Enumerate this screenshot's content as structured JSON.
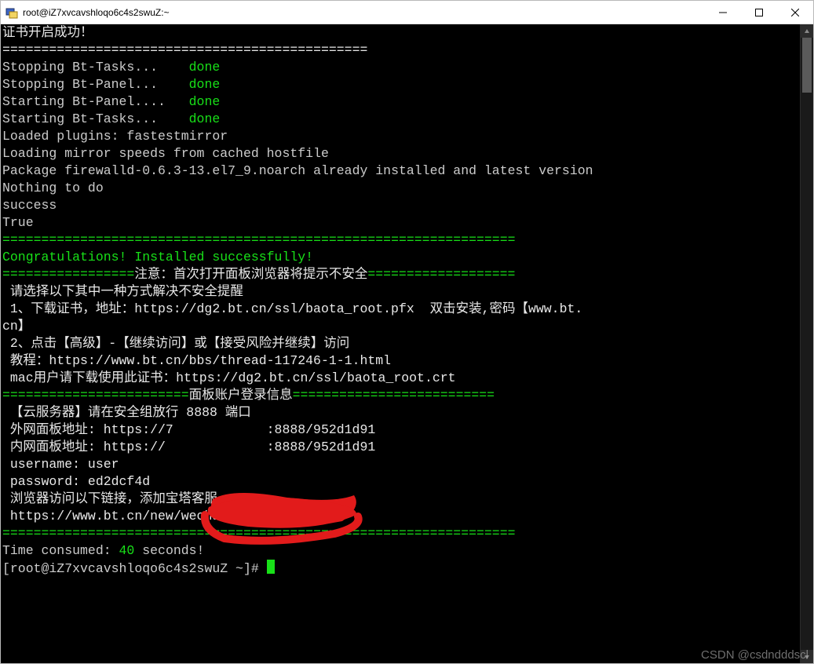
{
  "titlebar": {
    "title": "root@iZ7xvcavshloqo6c4s2swuZ:~"
  },
  "colors": {
    "term_bg": "#000000",
    "term_fg": "#cccccc",
    "green": "#18e018",
    "redact": "#e21b1b"
  },
  "terminal": {
    "lines": [
      {
        "segments": [
          {
            "text": "证书开启成功！",
            "class": "white"
          }
        ]
      },
      {
        "segments": [
          {
            "text": "===============================================",
            "class": "white"
          }
        ]
      },
      {
        "segments": [
          {
            "text": "",
            "class": ""
          }
        ]
      },
      {
        "segments": [
          {
            "text": "Stopping Bt-Tasks...    ",
            "class": "gray"
          },
          {
            "text": "done",
            "class": "green"
          }
        ]
      },
      {
        "segments": [
          {
            "text": "Stopping Bt-Panel...    ",
            "class": "gray"
          },
          {
            "text": "done",
            "class": "green"
          }
        ]
      },
      {
        "segments": [
          {
            "text": "Starting Bt-Panel....   ",
            "class": "gray"
          },
          {
            "text": "done",
            "class": "green"
          }
        ]
      },
      {
        "segments": [
          {
            "text": "Starting Bt-Tasks...    ",
            "class": "gray"
          },
          {
            "text": "done",
            "class": "green"
          }
        ]
      },
      {
        "segments": [
          {
            "text": "Loaded plugins: fastestmirror",
            "class": "gray"
          }
        ]
      },
      {
        "segments": [
          {
            "text": "Loading mirror speeds from cached hostfile",
            "class": "gray"
          }
        ]
      },
      {
        "segments": [
          {
            "text": "Package firewalld-0.6.3-13.el7_9.noarch already installed and latest version",
            "class": "gray"
          }
        ]
      },
      {
        "segments": [
          {
            "text": "Nothing to do",
            "class": "gray"
          }
        ]
      },
      {
        "segments": [
          {
            "text": "success",
            "class": "gray"
          }
        ]
      },
      {
        "segments": [
          {
            "text": "True",
            "class": "gray"
          }
        ]
      },
      {
        "segments": [
          {
            "text": "==================================================================",
            "class": "green"
          }
        ]
      },
      {
        "segments": [
          {
            "text": "Congratulations! Installed successfully!",
            "class": "green"
          }
        ]
      },
      {
        "segments": [
          {
            "text": "=================",
            "class": "green"
          },
          {
            "text": "注意：首次打开面板浏览器将提示不安全",
            "class": "white"
          },
          {
            "text": "===================",
            "class": "green"
          }
        ]
      },
      {
        "segments": [
          {
            "text": "",
            "class": ""
          }
        ]
      },
      {
        "segments": [
          {
            "text": " 请选择以下其中一种方式解决不安全提醒",
            "class": "white"
          }
        ]
      },
      {
        "segments": [
          {
            "text": " 1、下载证书，地址：https://dg2.bt.cn/ssl/baota_root.pfx  双击安装,密码【www.bt.",
            "class": "white"
          }
        ]
      },
      {
        "segments": [
          {
            "text": "cn】",
            "class": "white"
          }
        ]
      },
      {
        "segments": [
          {
            "text": " 2、点击【高级】-【继续访问】或【接受风险并继续】访问",
            "class": "white"
          }
        ]
      },
      {
        "segments": [
          {
            "text": " 教程：https://www.bt.cn/bbs/thread-117246-1-1.html",
            "class": "white"
          }
        ]
      },
      {
        "segments": [
          {
            "text": " mac用户请下载使用此证书：https://dg2.bt.cn/ssl/baota_root.crt",
            "class": "white"
          }
        ]
      },
      {
        "segments": [
          {
            "text": "",
            "class": ""
          }
        ]
      },
      {
        "segments": [
          {
            "text": "========================",
            "class": "green"
          },
          {
            "text": "面板账户登录信息",
            "class": "white"
          },
          {
            "text": "==========================",
            "class": "green"
          }
        ]
      },
      {
        "segments": [
          {
            "text": "",
            "class": ""
          }
        ]
      },
      {
        "segments": [
          {
            "text": " 【云服务器】请在安全组放行 8888 端口",
            "class": "white"
          }
        ]
      },
      {
        "segments": [
          {
            "text": " 外网面板地址: https://7            :8888/952d1d91",
            "class": "white"
          }
        ]
      },
      {
        "segments": [
          {
            "text": " 内网面板地址: https://             :8888/952d1d91",
            "class": "white"
          }
        ]
      },
      {
        "segments": [
          {
            "text": " username: user",
            "class": "white"
          }
        ]
      },
      {
        "segments": [
          {
            "text": " password: ed2dcf4d",
            "class": "white"
          }
        ]
      },
      {
        "segments": [
          {
            "text": "",
            "class": ""
          }
        ]
      },
      {
        "segments": [
          {
            "text": " 浏览器访问以下链接，添加宝塔客服",
            "class": "white"
          }
        ]
      },
      {
        "segments": [
          {
            "text": " https://www.bt.cn/new/wechat_customer",
            "class": "white"
          }
        ]
      },
      {
        "segments": [
          {
            "text": "==================================================================",
            "class": "green"
          }
        ]
      },
      {
        "segments": [
          {
            "text": "Time consumed: ",
            "class": "gray"
          },
          {
            "text": "40",
            "class": "green"
          },
          {
            "text": " seconds!",
            "class": "gray"
          }
        ]
      },
      {
        "segments": [
          {
            "text": "[root@iZ7xvcavshloqo6c4s2swuZ ~]# ",
            "class": "gray"
          }
        ],
        "cursor": true
      }
    ]
  },
  "watermark": "CSDN @csdndddscl"
}
